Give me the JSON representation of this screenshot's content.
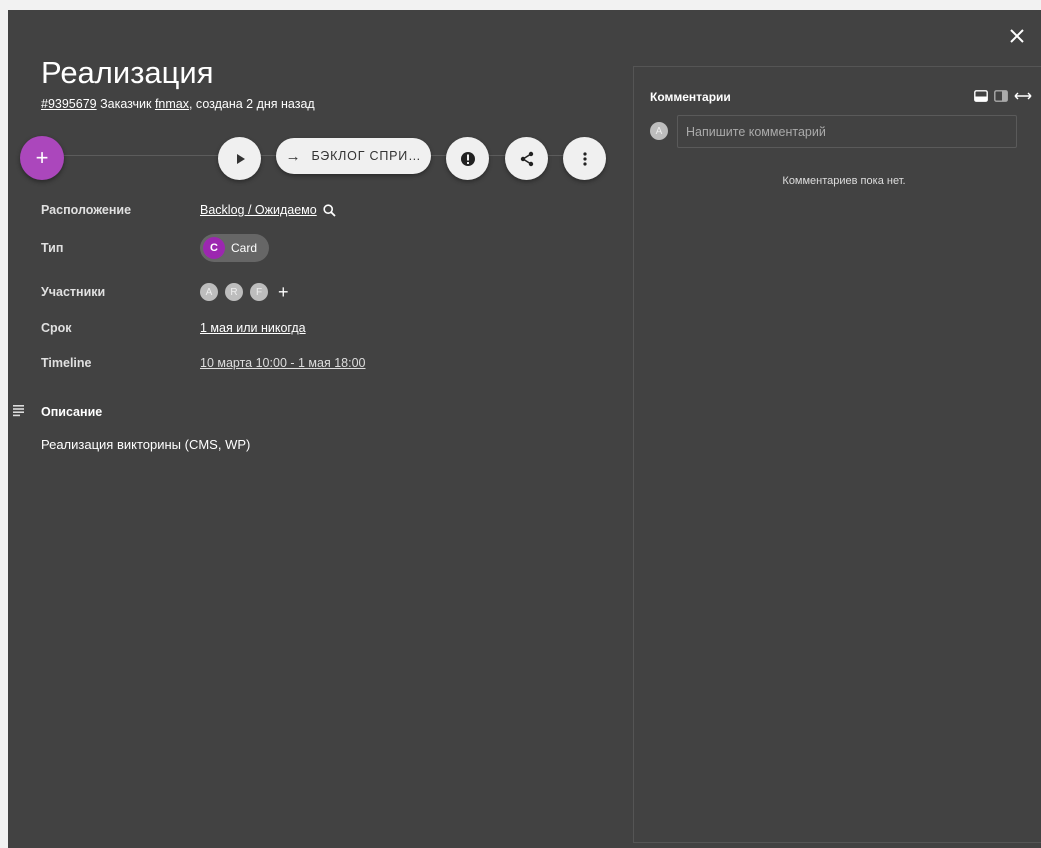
{
  "card": {
    "title": "Реализация",
    "id": "#9395679",
    "customer_prefix": "Заказчик",
    "customer": "fnmax",
    "created": ", создана 2 дня назад"
  },
  "toolbar": {
    "add_label": "+",
    "move_label": "БЭКЛОГ СПРИ…",
    "move_arrow": "→"
  },
  "props": {
    "location_label": "Расположение",
    "location_value": "Backlog / Ожидаемо",
    "type_label": "Тип",
    "type_letter": "C",
    "type_value": "Card",
    "members_label": "Участники",
    "members": [
      "A",
      "R",
      "F"
    ],
    "add_member": "+",
    "due_label": "Срок",
    "due_value": "1 мая или никогда",
    "timeline_label": "Timeline",
    "timeline_value": "10 марта 10:00 - 1 мая 18:00"
  },
  "description": {
    "heading": "Описание",
    "text": "Реализация викторины (CMS, WP)"
  },
  "comments": {
    "title": "Комментарии",
    "avatar": "A",
    "placeholder": "Напишите комментарий",
    "empty": "Комментариев пока нет."
  },
  "colors": {
    "accent": "#ab47bc",
    "panel": "#424242",
    "type_chip": "#9c27b0"
  }
}
